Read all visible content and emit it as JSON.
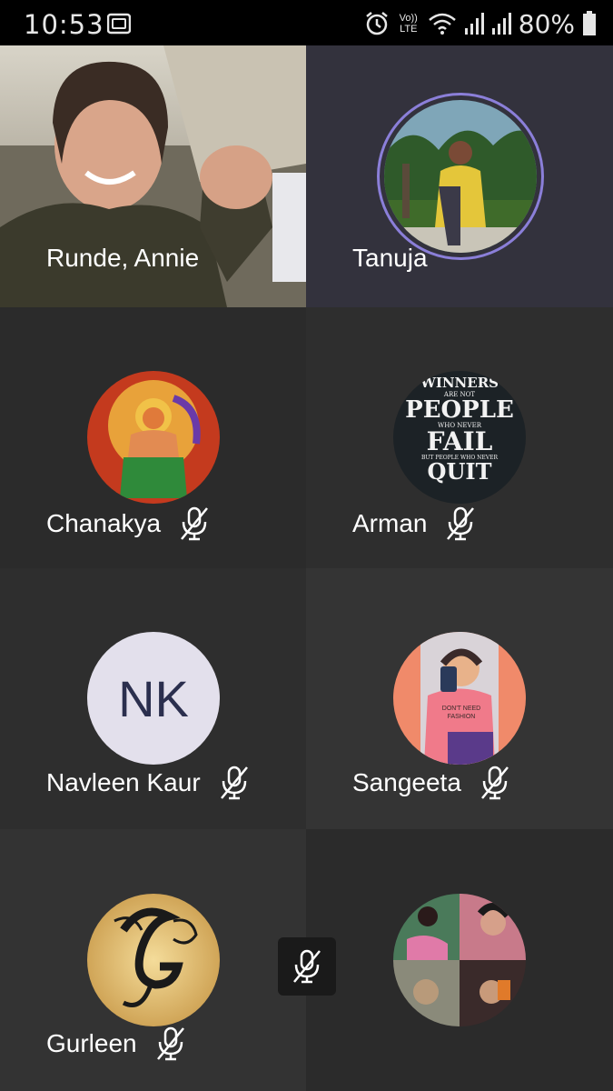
{
  "status_bar": {
    "time": "10:53",
    "network_label": "Vo)) LTE",
    "battery_percent": "80%"
  },
  "participants": [
    {
      "name": "Runde, Annie",
      "muted": false,
      "type": "video"
    },
    {
      "name": "Tanuja",
      "muted": false,
      "type": "photo"
    },
    {
      "name": "Chanakya",
      "muted": true,
      "type": "photo"
    },
    {
      "name": "Arman",
      "muted": true,
      "type": "photo"
    },
    {
      "name": "Navleen Kaur",
      "muted": true,
      "type": "initials",
      "initials": "NK"
    },
    {
      "name": "Sangeeta",
      "muted": true,
      "type": "photo"
    },
    {
      "name": "Gurleen",
      "muted": true,
      "type": "photo"
    },
    {
      "name": "",
      "muted": false,
      "type": "photo"
    }
  ],
  "arman_avatar_text": [
    "WINNERS",
    "ARE NOT",
    "PEOPLE",
    "WHO NEVER",
    "FAIL",
    "BUT PEOPLE WHO NEVER",
    "QUIT"
  ],
  "sangeeta_shirt_text": "DON'T NEED FASHION",
  "colors": {
    "tile_dark": "#2a2a2a",
    "tile_light": "#343434",
    "active_ring": "#8b7fd9",
    "tanuja_tile": "#33323d"
  }
}
